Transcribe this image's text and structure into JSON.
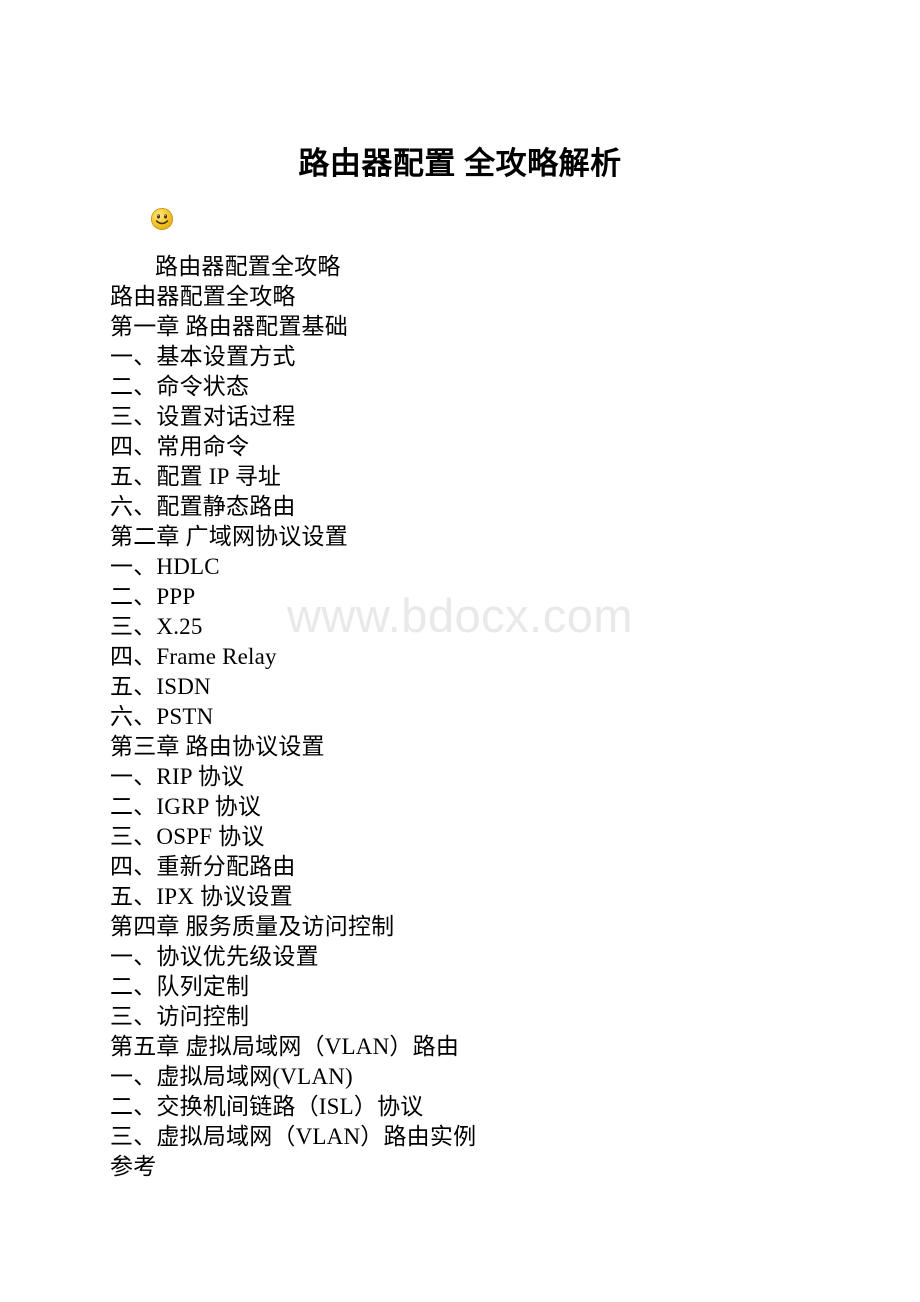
{
  "document": {
    "title": "路由器配置 全攻略解析",
    "watermark": "www.bdocx.com",
    "emoji": {
      "name": "smiley-face",
      "glyph": "🙂",
      "color_face": "#f5c228",
      "color_shade": "#d79a0a",
      "color_highlight": "#fbe48a"
    },
    "colors": {
      "text": "#000000",
      "background": "#ffffff",
      "watermark": "#e9e9e9"
    },
    "lines": [
      {
        "text": "路由器配置全攻略",
        "indent": true
      },
      {
        "text": "路由器配置全攻略",
        "indent": false
      },
      {
        "text": "第一章 路由器配置基础",
        "indent": false
      },
      {
        "text": "一、基本设置方式",
        "indent": false
      },
      {
        "text": "二、命令状态",
        "indent": false
      },
      {
        "text": "三、设置对话过程",
        "indent": false
      },
      {
        "text": "四、常用命令",
        "indent": false
      },
      {
        "text": "五、配置 IP 寻址",
        "indent": false
      },
      {
        "text": "六、配置静态路由",
        "indent": false
      },
      {
        "text": "第二章 广域网协议设置",
        "indent": false
      },
      {
        "text": "一、HDLC",
        "indent": false
      },
      {
        "text": "二、PPP",
        "indent": false
      },
      {
        "text": "三、X.25",
        "indent": false
      },
      {
        "text": "四、Frame Relay",
        "indent": false
      },
      {
        "text": "五、ISDN",
        "indent": false
      },
      {
        "text": "六、PSTN",
        "indent": false
      },
      {
        "text": "第三章 路由协议设置",
        "indent": false
      },
      {
        "text": "一、RIP 协议",
        "indent": false
      },
      {
        "text": "二、IGRP 协议",
        "indent": false
      },
      {
        "text": "三、OSPF 协议",
        "indent": false
      },
      {
        "text": "四、重新分配路由",
        "indent": false
      },
      {
        "text": "五、IPX 协议设置",
        "indent": false
      },
      {
        "text": "第四章 服务质量及访问控制",
        "indent": false
      },
      {
        "text": "一、协议优先级设置",
        "indent": false
      },
      {
        "text": "二、队列定制",
        "indent": false
      },
      {
        "text": "三、访问控制",
        "indent": false
      },
      {
        "text": "第五章 虚拟局域网（VLAN）路由",
        "indent": false
      },
      {
        "text": "一、虚拟局域网(VLAN)",
        "indent": false
      },
      {
        "text": "二、交换机间链路（ISL）协议",
        "indent": false
      },
      {
        "text": "三、虚拟局域网（VLAN）路由实例",
        "indent": false
      },
      {
        "text": "参考",
        "indent": false
      }
    ]
  }
}
